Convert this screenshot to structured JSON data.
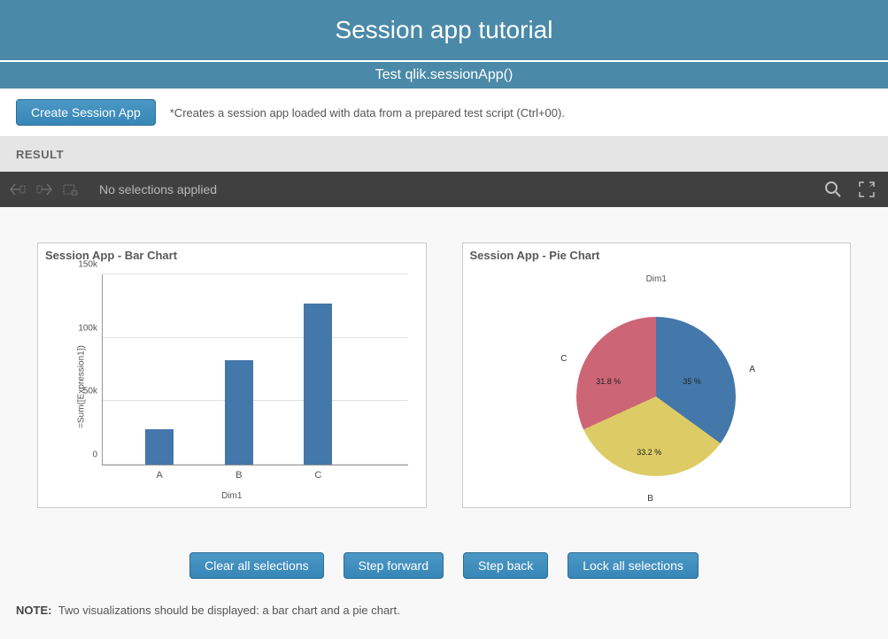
{
  "header": {
    "title": "Session app tutorial",
    "subtitle": "Test qlik.sessionApp()"
  },
  "create_bar": {
    "button_label": "Create Session App",
    "description": "*Creates a session app loaded with data from a prepared test script (Ctrl+00)."
  },
  "result_label": "RESULT",
  "selection_bar": {
    "text": "No selections applied"
  },
  "charts": {
    "bar": {
      "title": "Session App - Bar Chart",
      "ylabel": "=Sum([Expression1])",
      "xlabel": "Dim1"
    },
    "pie": {
      "title": "Session App - Pie Chart",
      "dim_label": "Dim1"
    }
  },
  "chart_data": [
    {
      "type": "bar",
      "title": "Session App - Bar Chart",
      "xlabel": "Dim1",
      "ylabel": "=Sum([Expression1])",
      "categories": [
        "A",
        "B",
        "C"
      ],
      "values": [
        28000,
        82000,
        127000
      ],
      "ylim": [
        0,
        150000
      ],
      "yticks": [
        0,
        50000,
        100000,
        150000
      ],
      "ytick_labels": [
        "0",
        "50k",
        "100k",
        "150k"
      ],
      "bar_color": "#4477aa"
    },
    {
      "type": "pie",
      "title": "Session App - Pie Chart",
      "dim_label": "Dim1",
      "series": [
        {
          "name": "A",
          "value": 35.0,
          "color": "#4477aa",
          "label": "35 %"
        },
        {
          "name": "B",
          "value": 33.2,
          "color": "#ddcc66",
          "label": "33.2 %"
        },
        {
          "name": "C",
          "value": 31.8,
          "color": "#cc6677",
          "label": "31.8 %"
        }
      ]
    }
  ],
  "actions": {
    "clear": "Clear all selections",
    "forward": "Step forward",
    "back": "Step back",
    "lock": "Lock all selections"
  },
  "note": {
    "label": "NOTE:",
    "text": "Two visualizations should be displayed: a bar chart and a pie chart."
  }
}
